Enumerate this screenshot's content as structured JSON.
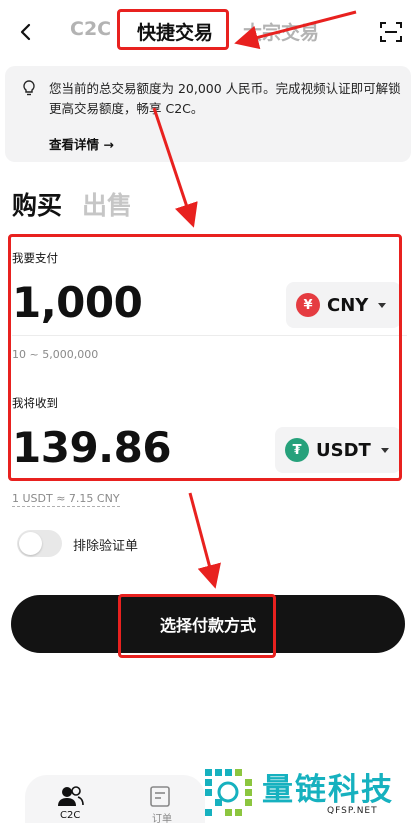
{
  "header": {
    "tabs": [
      {
        "label": "C2C",
        "active": false
      },
      {
        "label": "快捷交易",
        "active": true
      },
      {
        "label": "大宗交易",
        "active": false
      }
    ]
  },
  "banner": {
    "text": "您当前的总交易额度为 20,000 人民币。完成视频认证即可解锁更高交易额度，畅享 C2C。",
    "link": "查看详情 →"
  },
  "mode": {
    "buy": "购买",
    "sell": "出售",
    "active": "buy"
  },
  "pay": {
    "label": "我要支付",
    "amount": "1,000",
    "currency": "CNY",
    "currency_symbol": "¥",
    "currency_color": "#e53c41",
    "range": "10 ~ 5,000,000"
  },
  "receive": {
    "label": "我将收到",
    "amount": "139.86",
    "currency": "USDT",
    "currency_symbol": "₮",
    "currency_color": "#26a17b"
  },
  "rate": "1 USDT ≈ 7.15 CNY",
  "toggle": {
    "label": "排除验证单",
    "on": false
  },
  "primary_button": "选择付款方式",
  "bottom_nav": [
    {
      "label": "C2C",
      "icon": "users-icon",
      "active": true
    },
    {
      "label": "订单",
      "icon": "orders-icon",
      "active": false
    }
  ],
  "watermark": {
    "text": "量链科技",
    "sub": "QFSP.NET"
  },
  "colors": {
    "accent": "#131313",
    "highlight": "#e8211f",
    "watermark": "#16b1bf"
  }
}
